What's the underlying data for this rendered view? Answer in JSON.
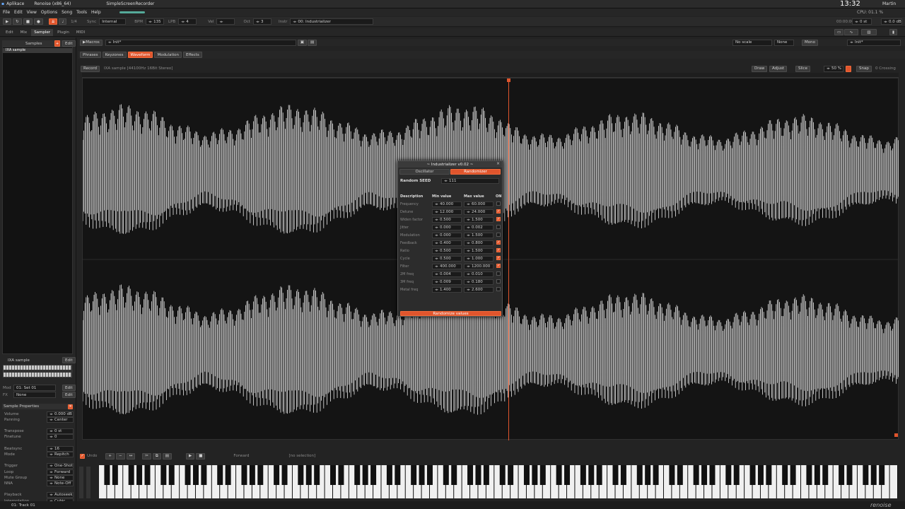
{
  "sysbar": {
    "app_menu": "Aplikace",
    "task1": "Renoise (x86_64)",
    "task2": "SimpleScreenRecorder",
    "clock": "13:32",
    "user": "Martin"
  },
  "menu": [
    "File",
    "Edit",
    "View",
    "Options",
    "Song",
    "Tools",
    "Help"
  ],
  "transport": {
    "pattern_step": "1/4",
    "sync_label": "Sync",
    "sync_value": "Internal",
    "bpm_label": "BPM",
    "bpm": "135",
    "lpb_label": "LPB",
    "lpb": "4",
    "vel_label": "Vel",
    "oct_label": "Oct",
    "oct": "3",
    "instr_label": "Instr",
    "instr": "00: Industrializer",
    "time": "00:00:00",
    "cpu": "CPU: 01.1 %",
    "master": "0 st",
    "gain": "0.0 dB"
  },
  "tabs": [
    "Edit",
    "Mix",
    "Sampler",
    "Plugin",
    "MIDI"
  ],
  "tab_active": 2,
  "left": {
    "samples_header": "Samples",
    "edit_btn": "Edit",
    "sample_item": "IXA sample",
    "keyzone_item": "IXA sample",
    "mod_label": "Mod",
    "mod_value": "01: Set 01",
    "fx_label": "FX",
    "fx_value": "None"
  },
  "sample_properties": {
    "title": "Sample Properties",
    "rows": [
      {
        "label": "Volume",
        "value": "0.000 dB"
      },
      {
        "label": "Panning",
        "value": "Center"
      },
      {
        "label": "Transpose",
        "value": "0 st"
      },
      {
        "label": "Finetune",
        "value": "0"
      },
      {
        "label": "Beatsync",
        "value": "16"
      },
      {
        "label": "Mode",
        "value": "Repitch"
      },
      {
        "label": "Trigger",
        "value": "One-Shot"
      },
      {
        "label": "Loop",
        "value": "Forward"
      },
      {
        "label": "Mute Group",
        "value": "None"
      },
      {
        "label": "NNA",
        "value": "Note-Off"
      },
      {
        "label": "Playback",
        "value": "Autoseek"
      },
      {
        "label": "Interpolation",
        "value": "Cubic"
      }
    ]
  },
  "macros": {
    "label": "Macros",
    "preset": "Init*",
    "scale": "No scale",
    "none": "None",
    "mono": "Mono",
    "preset2": "Init*"
  },
  "subtabs": [
    "Phrases",
    "Keyzones",
    "Waveform",
    "Modulation",
    "Effects"
  ],
  "subtab_active": 2,
  "wave_header": {
    "record": "Record",
    "info": "IXA sample [44100Hz 16Bit Stereo]",
    "draw": "Draw",
    "adjust": "Adjust",
    "slice": "Slice",
    "zoom": "50 %",
    "snap": "Snap",
    "crossing": "0 Crossing"
  },
  "bottom_toolbar": {
    "undo": "Undo",
    "direction": "Forward",
    "selection": "[no selection]"
  },
  "dialog": {
    "title": "~ Industrializer v0.02 ~",
    "tab_osc": "Oscillator",
    "tab_rand": "Randomizer",
    "seed_label": "Random SEED",
    "seed": "111",
    "col_desc": "Description",
    "col_min": "Min value",
    "col_max": "Max value",
    "col_on": "ON",
    "rows": [
      {
        "name": "Frequency",
        "min": "40.000",
        "max": "60.000",
        "on": false
      },
      {
        "name": "Detune",
        "min": "12.000",
        "max": "24.000",
        "on": true
      },
      {
        "name": "Widen factor",
        "min": "0.500",
        "max": "1.500",
        "on": true
      },
      {
        "name": "Jitter",
        "min": "0.000",
        "max": "0.002",
        "on": false
      },
      {
        "name": "Modulation",
        "min": "0.000",
        "max": "1.500",
        "on": false
      },
      {
        "name": "Feedback",
        "min": "0.400",
        "max": "0.800",
        "on": true
      },
      {
        "name": "Ratio",
        "min": "0.500",
        "max": "1.500",
        "on": true
      },
      {
        "name": "Cycle",
        "min": "0.500",
        "max": "1.000",
        "on": true
      },
      {
        "name": "Filter",
        "min": "400.000",
        "max": "1200.000",
        "on": true
      },
      {
        "name": "2M freq",
        "min": "0.004",
        "max": "0.010",
        "on": false
      },
      {
        "name": "3M freq",
        "min": "0.009",
        "max": "0.180",
        "on": false
      },
      {
        "name": "Metal freq",
        "min": "1.400",
        "max": "2.600",
        "on": false
      }
    ],
    "button": "Randomize values"
  },
  "status": {
    "track": "01: Track 01",
    "logo": "renoise"
  },
  "colors": {
    "accent": "#e0552d",
    "bg": "#232323",
    "wave": "#e8e8e8"
  }
}
